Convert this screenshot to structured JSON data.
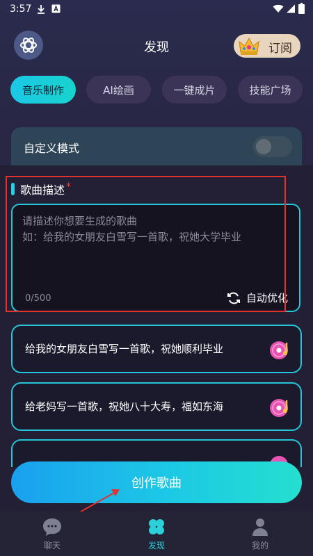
{
  "status_bar": {
    "time": "3:57"
  },
  "header": {
    "title": "发现",
    "subscribe_label": "订阅"
  },
  "tabs": [
    {
      "label": "音乐制作",
      "active": true
    },
    {
      "label": "AI绘画",
      "active": false
    },
    {
      "label": "一键成片",
      "active": false
    },
    {
      "label": "技能广场",
      "active": false
    }
  ],
  "custom_mode": {
    "label": "自定义模式",
    "enabled": false
  },
  "song_description": {
    "title": "歌曲描述",
    "required_mark": "*",
    "placeholder": "请描述你想要生成的歌曲\n如：给我的女朋友白雪写一首歌，祝她大学毕业",
    "counter": "0/500",
    "optimize_label": "自动优化"
  },
  "suggestions": [
    {
      "text": "给我的女朋友白雪写一首歌，祝她顺利毕业"
    },
    {
      "text": "给老妈写一首歌，祝她八十大寿，福如东海"
    }
  ],
  "create_button": {
    "label": "创作歌曲"
  },
  "bottom_nav": [
    {
      "label": "聊天",
      "active": false
    },
    {
      "label": "发现",
      "active": true
    },
    {
      "label": "我的",
      "active": false
    }
  ],
  "colors": {
    "accent": "#26c6d8",
    "highlight_box": "#e13131",
    "background": "#231f34"
  }
}
